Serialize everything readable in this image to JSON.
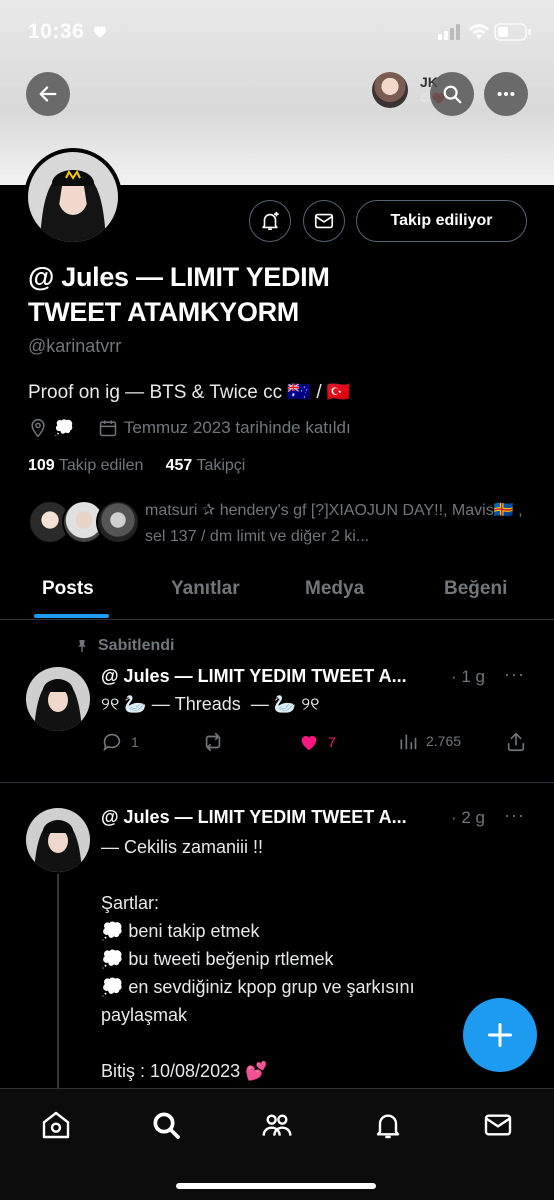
{
  "status": {
    "time": "10:36"
  },
  "header": {
    "jk_label": "JK",
    "jk_emoji": "😊❤️"
  },
  "profile": {
    "follow_button": "Takip ediliyor",
    "display_name": "@ Jules — LIMIT YEDIM TWEET ATAMKYORM",
    "handle": "@karinatvrr",
    "bio": "Proof on ig — BTS & Twice cc 🇦🇺 / 🇹🇷",
    "location": "💭",
    "joined": "Temmuz 2023 tarihinde katıldı",
    "following_count": "109",
    "following_label": "Takip edilen",
    "followers_count": "457",
    "followers_label": "Takipçi",
    "followed_by": "matsuri ✰ hendery's gf [?]XIAOJUN DAY!!, Mavis🇦🇽 , sel 137 / dm limit ve diğer 2 ki..."
  },
  "tabs": [
    {
      "label": "Posts"
    },
    {
      "label": "Yanıtlar"
    },
    {
      "label": "Medya"
    },
    {
      "label": "Beğeni"
    }
  ],
  "tweets": [
    {
      "pinned_label": "Sabitlendi",
      "author": "@ Jules — LIMIT YEDIM TWEET A...",
      "time": "· 1 g",
      "text": "୨୧ 🦢 — Threads  — 🦢 ୨୧",
      "replies": "1",
      "likes": "7",
      "views": "2.765"
    },
    {
      "author": "@ Jules — LIMIT YEDIM TWEET A...",
      "time": "· 2 g",
      "text": "— Cekilis zamaniii !!\n\nŞartlar:\n💭 beni takip etmek\n💭 bu tweeti beğenip rtlemek\n💭 en sevdiğiniz kpop grup ve şarkısını\npaylaşmak\n\nBitiş : 10/08/2023 💕"
    }
  ],
  "colors": {
    "accent": "#1d9bf0",
    "like": "#f91880",
    "muted": "#71767b"
  }
}
